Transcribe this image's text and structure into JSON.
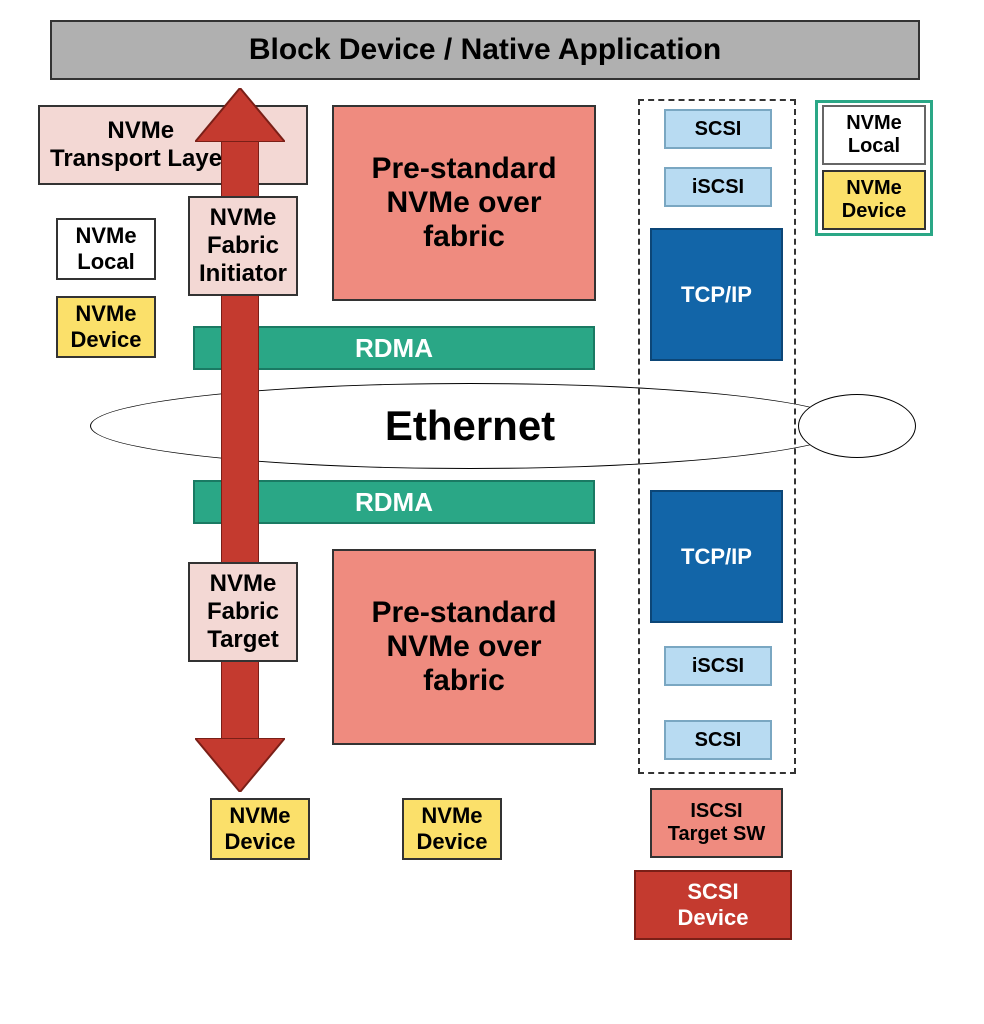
{
  "title": "Block Device / Native Application",
  "ethernet": "Ethernet",
  "left": {
    "transport_layer": "NVMe\nTransport Layer",
    "nvme_local": "NVMe\nLocal",
    "nvme_device": "NVMe\nDevice"
  },
  "arrow": {
    "fabric_initiator": "NVMe\nFabric\nInitiator",
    "fabric_target": "NVMe\nFabric\nTarget",
    "nvme_device_bottom": "NVMe\nDevice"
  },
  "center": {
    "pre_standard_top": "Pre-standard\nNVMe over\nfabric",
    "pre_standard_bottom": "Pre-standard\nNVMe over\nfabric",
    "rdma_top": "RDMA",
    "rdma_bottom": "RDMA",
    "nvme_device_bottom": "NVMe\nDevice"
  },
  "right": {
    "green_group": {
      "nvme_local": "NVMe\nLocal",
      "nvme_device": "NVMe\nDevice"
    },
    "top_stack": {
      "scsi": "SCSI",
      "iscsi": "iSCSI",
      "tcpip": "TCP/IP"
    },
    "bottom_stack": {
      "tcpip": "TCP/IP",
      "iscsi": "iSCSI",
      "scsi": "SCSI"
    },
    "iscsi_target_sw": "ISCSI\nTarget SW",
    "scsi_device": "SCSI\nDevice"
  }
}
